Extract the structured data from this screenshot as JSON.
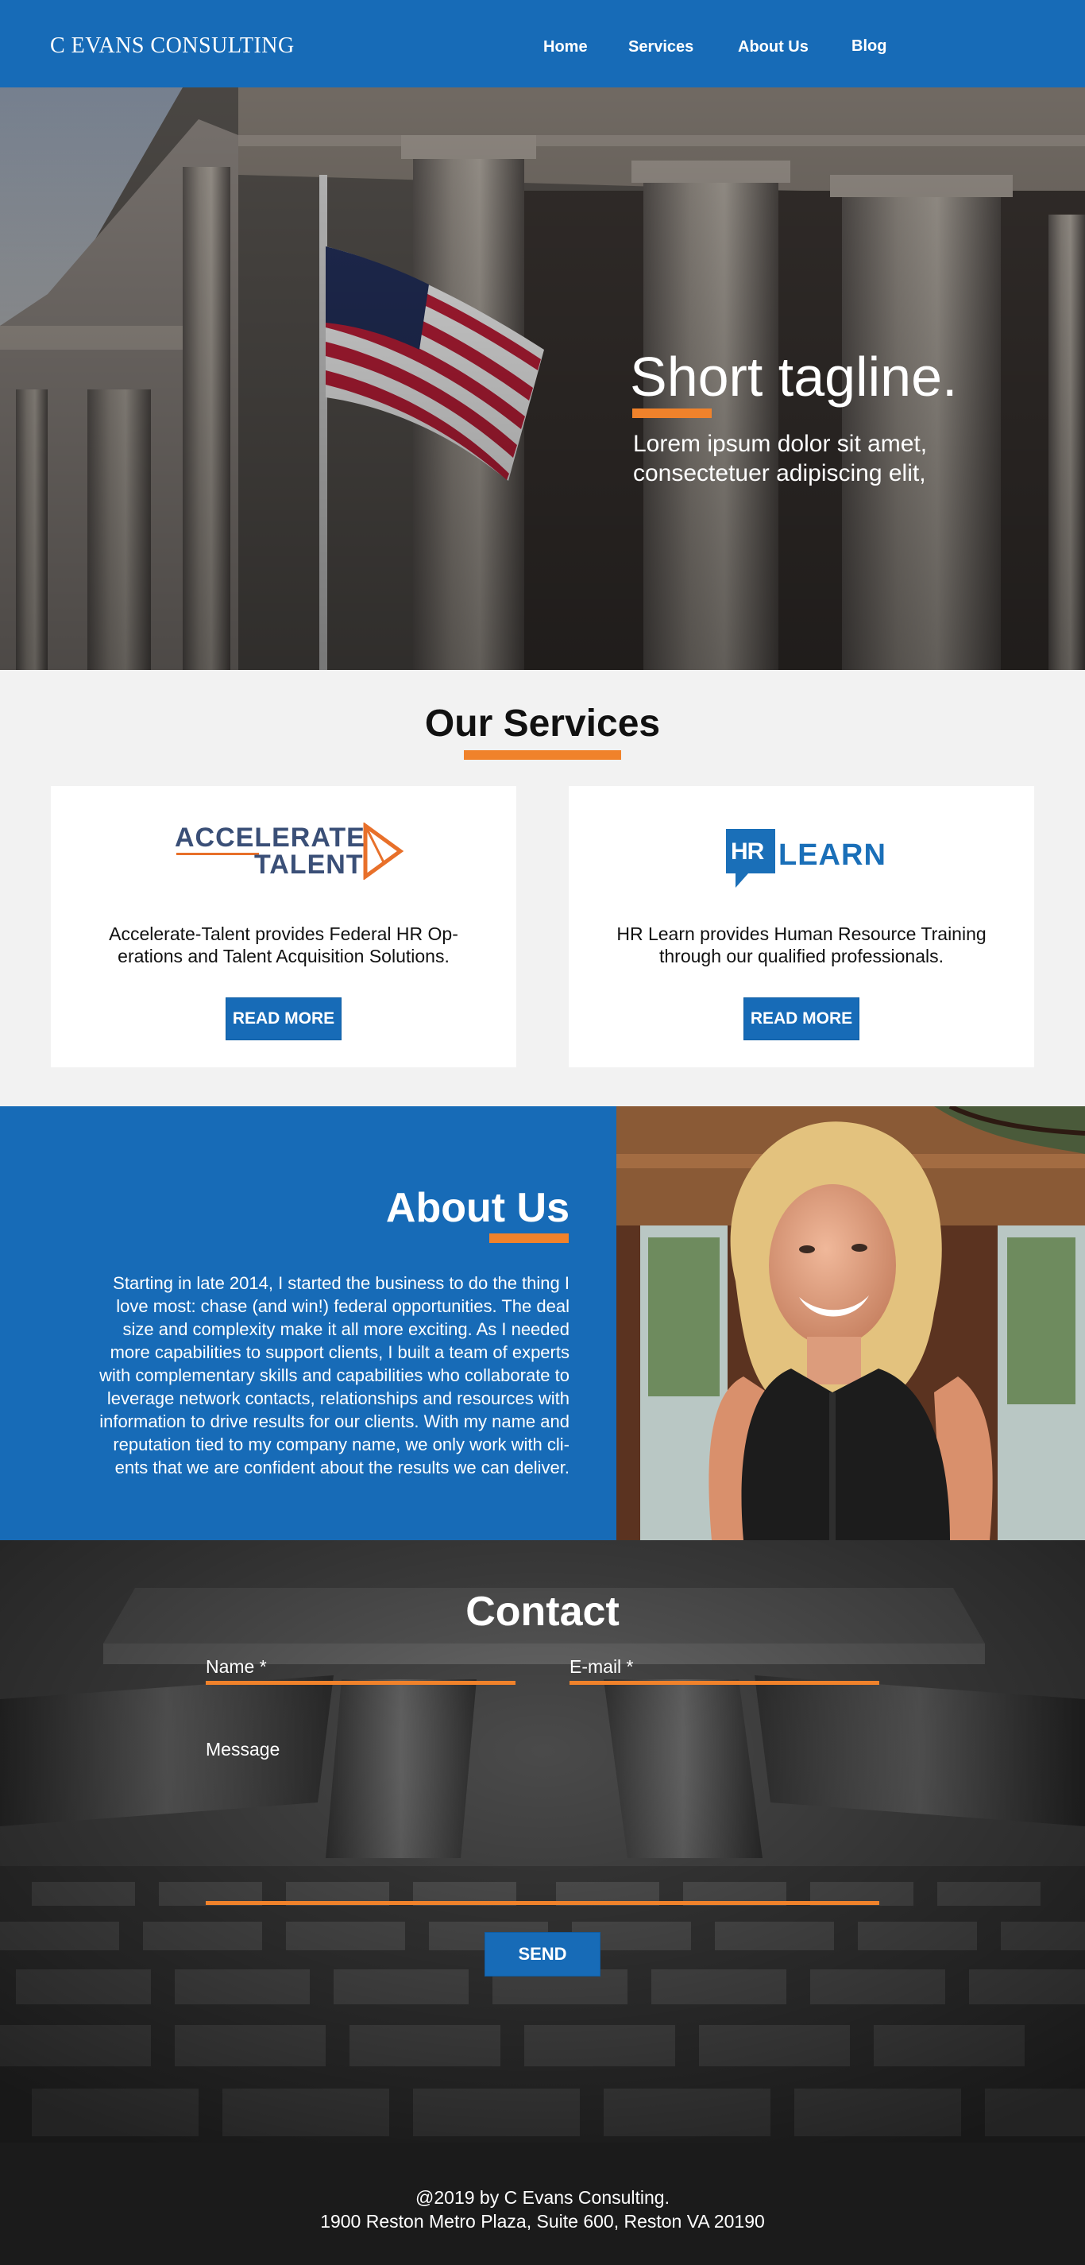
{
  "header": {
    "logo": "C EVANS CONSULTING",
    "nav": [
      "Home",
      "Services",
      "About Us",
      "Blog"
    ]
  },
  "hero": {
    "title": "Short tagline.",
    "subtitle_line1": "Lorem ipsum dolor sit amet,",
    "subtitle_line2": "consectetuer adipiscing elit,"
  },
  "services": {
    "title": "Our Services",
    "cards": [
      {
        "logo_line1": "ACCELERATE",
        "logo_line2": "TALENT",
        "text_line1": "Accelerate-Talent provides Federal HR Op-",
        "text_line2": "erations and Talent Acquisition Solutions.",
        "button": "READ MORE"
      },
      {
        "logo_mark": "HR",
        "logo_word": "LEARN",
        "text_line1": "HR Learn provides Human Resource Training",
        "text_line2": "through our qualified professionals.",
        "button": "READ MORE"
      }
    ]
  },
  "about": {
    "title": "About Us",
    "lines": [
      "Starting in late 2014, I started the business to do the thing I",
      "love most:  chase (and win!) federal opportunities.  The deal",
      "size and complexity make it all more exciting. As I needed",
      "more capabilities to support clients, I built a team of experts",
      "with complementary skills and capabilities who collaborate to",
      "leverage network contacts, relationships and resources with",
      "information to drive results for our clients.  With my name and",
      "reputation tied to my company name, we only work with cli-",
      "ents that we are confident about the results we can deliver."
    ]
  },
  "contact": {
    "title": "Contact",
    "name_label": "Name *",
    "email_label": "E-mail *",
    "message_label": "Message",
    "send": "SEND"
  },
  "footer": {
    "line1": "@2019 by C Evans Consulting.",
    "line2": "1900 Reston Metro Plaza, Suite 600, Reston VA 20190"
  },
  "colors": {
    "brand_blue": "#176bb7",
    "accent_orange": "#f0822b",
    "footer_dark": "#1b1b1b"
  }
}
